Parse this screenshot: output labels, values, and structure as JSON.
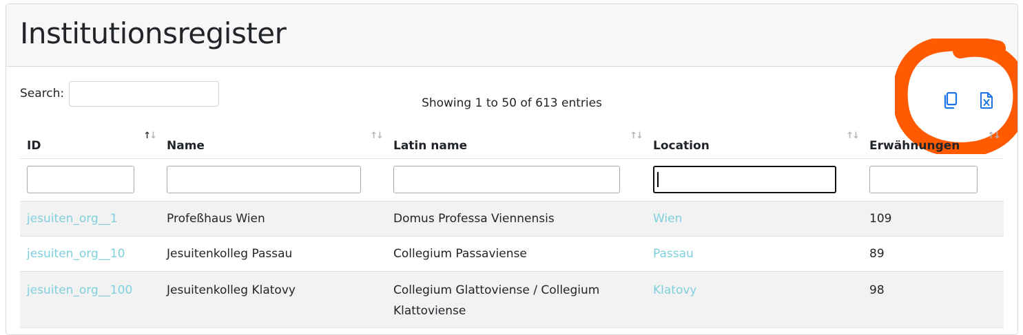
{
  "header": {
    "title": "Institutionsregister"
  },
  "search": {
    "label": "Search:",
    "value": ""
  },
  "info": "Showing 1 to 50 of 613 entries",
  "export": {
    "copy_icon": "copy-icon",
    "excel_icon": "excel-file-icon"
  },
  "table": {
    "columns": [
      {
        "label": "ID",
        "sort": "ascending"
      },
      {
        "label": "Name",
        "sort": "none"
      },
      {
        "label": "Latin name",
        "sort": "none"
      },
      {
        "label": "Location",
        "sort": "none"
      },
      {
        "label": "Erwähnungen",
        "sort": "none"
      }
    ],
    "sort_glyph": "↑↓",
    "rows": [
      {
        "id": "jesuiten_org__1",
        "name": "Profeßhaus Wien",
        "latin": "Domus Professa Viennensis",
        "location": "Wien",
        "mentions": "109"
      },
      {
        "id": "jesuiten_org__10",
        "name": "Jesuitenkolleg Passau",
        "latin": "Collegium Passaviense",
        "location": "Passau",
        "mentions": "89"
      },
      {
        "id": "jesuiten_org__100",
        "name": "Jesuitenkolleg Klatovy",
        "latin": "Collegium Glattoviense / Collegium Klattoviense",
        "location": "Klatovy",
        "mentions": "98"
      }
    ]
  },
  "colors": {
    "link": "#7fd0dd",
    "export_icon": "#1a73e8",
    "annotation": "#ff5a00",
    "header_bg": "#f7f7f7",
    "stripe": "#f2f2f2"
  }
}
